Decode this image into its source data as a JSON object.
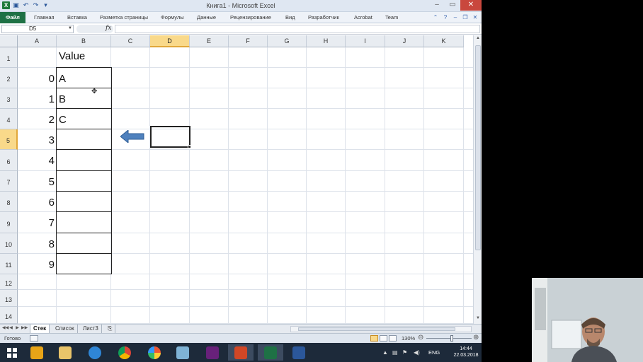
{
  "window": {
    "title": "Книга1 - Microsoft Excel"
  },
  "ribbon": {
    "tabs": [
      {
        "label": "Файл",
        "name": "tab-file"
      },
      {
        "label": "Главная",
        "name": "tab-home"
      },
      {
        "label": "Вставка",
        "name": "tab-insert"
      },
      {
        "label": "Разметка страницы",
        "name": "tab-page-layout"
      },
      {
        "label": "Формулы",
        "name": "tab-formulas"
      },
      {
        "label": "Данные",
        "name": "tab-data"
      },
      {
        "label": "Рецензирование",
        "name": "tab-review"
      },
      {
        "label": "Вид",
        "name": "tab-view"
      },
      {
        "label": "Разработчик",
        "name": "tab-developer"
      },
      {
        "label": "Acrobat",
        "name": "tab-acrobat"
      },
      {
        "label": "Team",
        "name": "tab-team"
      }
    ]
  },
  "formula_bar": {
    "name_box": "D5",
    "fx": "fx",
    "formula": ""
  },
  "grid": {
    "columns": [
      "A",
      "B",
      "C",
      "D",
      "E",
      "F",
      "G",
      "H",
      "I",
      "J",
      "K"
    ],
    "active_column": "D",
    "rows": [
      "1",
      "2",
      "3",
      "4",
      "5",
      "6",
      "7",
      "8",
      "9",
      "10",
      "11",
      "12",
      "13",
      "14"
    ],
    "active_row": "5",
    "header_b1": "Value",
    "col_a_values": [
      "0",
      "1",
      "2",
      "3",
      "4",
      "5",
      "6",
      "7",
      "8",
      "9"
    ],
    "col_b_values": [
      "A",
      "B",
      "C",
      "",
      "",
      "",
      "",
      "",
      "",
      ""
    ]
  },
  "sheets": {
    "tabs": [
      "Стек",
      "Список",
      "Лист3"
    ],
    "active": "Стек"
  },
  "status": {
    "ready": "Готово",
    "zoom": "130%"
  },
  "taskbar": {
    "lang": "ENG",
    "time": "14:44",
    "date": "22.03.2018"
  },
  "colors": {
    "excel_green": "#1e7145",
    "active_header": "#f9d98a",
    "arrow_blue": "#4f81bd"
  }
}
